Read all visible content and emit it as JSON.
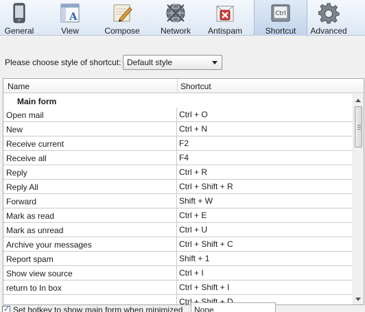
{
  "toolbar": {
    "items": [
      {
        "label": "General",
        "icon": "phone-icon"
      },
      {
        "label": "View",
        "icon": "window-font-icon"
      },
      {
        "label": "Compose",
        "icon": "pencil-note-icon"
      },
      {
        "label": "Network",
        "icon": "globe-icon"
      },
      {
        "label": "Antispam",
        "icon": "blocked-mail-icon"
      },
      {
        "label": "Shortcut",
        "icon": "ctrl-key-icon"
      },
      {
        "label": "Advanced",
        "icon": "gear-icon"
      }
    ],
    "active": "Shortcut",
    "ctrl_key_text": "Ctrl"
  },
  "style_chooser": {
    "label": "Please choose style of shortcut:",
    "selected": "Default style"
  },
  "table": {
    "headers": {
      "name": "Name",
      "shortcut": "Shortcut"
    },
    "group": "Main form",
    "rows": [
      {
        "name": "Open mail",
        "shortcut": "Ctrl + O"
      },
      {
        "name": "New",
        "shortcut": "Ctrl + N"
      },
      {
        "name": "Receive current",
        "shortcut": "F2"
      },
      {
        "name": "Receive all",
        "shortcut": "F4"
      },
      {
        "name": "Reply",
        "shortcut": "Ctrl + R"
      },
      {
        "name": "Reply All",
        "shortcut": "Ctrl + Shift + R"
      },
      {
        "name": "Forward",
        "shortcut": "Shift + W"
      },
      {
        "name": "Mark as read",
        "shortcut": "Ctrl + E"
      },
      {
        "name": "Mark as unread",
        "shortcut": "Ctrl + U"
      },
      {
        "name": "Archive your messages",
        "shortcut": "Ctrl + Shift + C"
      },
      {
        "name": "Report spam",
        "shortcut": "Shift + 1"
      },
      {
        "name": "Show view source",
        "shortcut": "Ctrl + I"
      },
      {
        "name": "return to In box",
        "shortcut": "Ctrl + Shift + I"
      },
      {
        "name": "",
        "shortcut": "Ctrl + Shift + D"
      }
    ]
  },
  "hotkey": {
    "label": "Set hotkey to show main form when minimized",
    "checked": true,
    "value": "None"
  },
  "colors": {
    "toolbar_bg": "#dde7f4",
    "active_tab": "#c2d4ec",
    "checkmark": "#1a5fb4"
  }
}
